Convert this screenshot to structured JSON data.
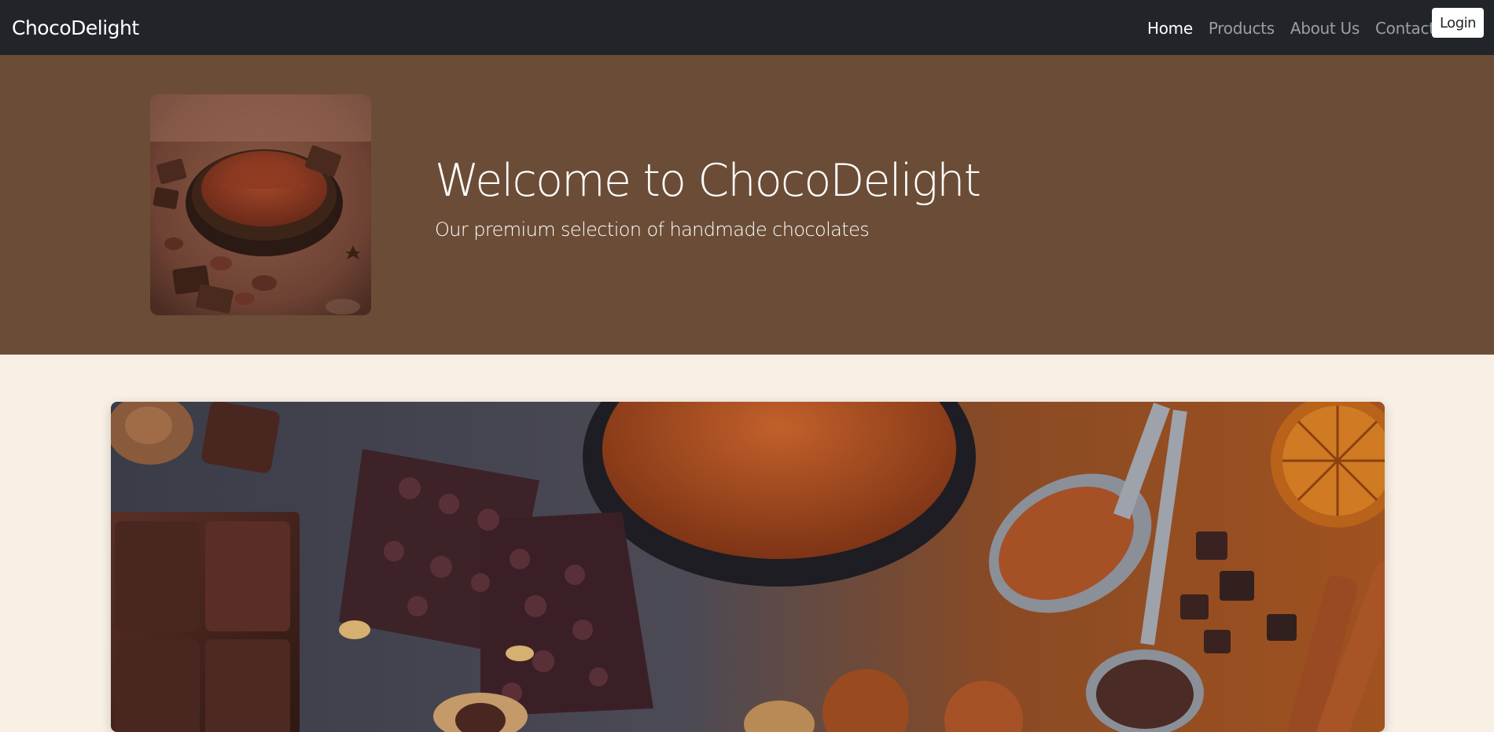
{
  "navbar": {
    "brand": "ChocoDelight",
    "links": [
      {
        "label": "Home",
        "active": true
      },
      {
        "label": "Products",
        "active": false
      },
      {
        "label": "About Us",
        "active": false
      },
      {
        "label": "Contact",
        "active": false
      }
    ],
    "login_label": "Login"
  },
  "hero": {
    "title": "Welcome to ChocoDelight",
    "subtitle": "Our premium selection of handmade chocolates",
    "image_alt": "Cocoa powder bowl with chocolate pieces and cocoa beans"
  },
  "banner": {
    "image_alt": "Assorted chocolates, cocoa powder, spoons, dried orange and cinnamon sticks"
  },
  "colors": {
    "navbar_bg": "#212529",
    "hero_bg": "#6b4d37",
    "page_bg": "#f8f0e5"
  }
}
